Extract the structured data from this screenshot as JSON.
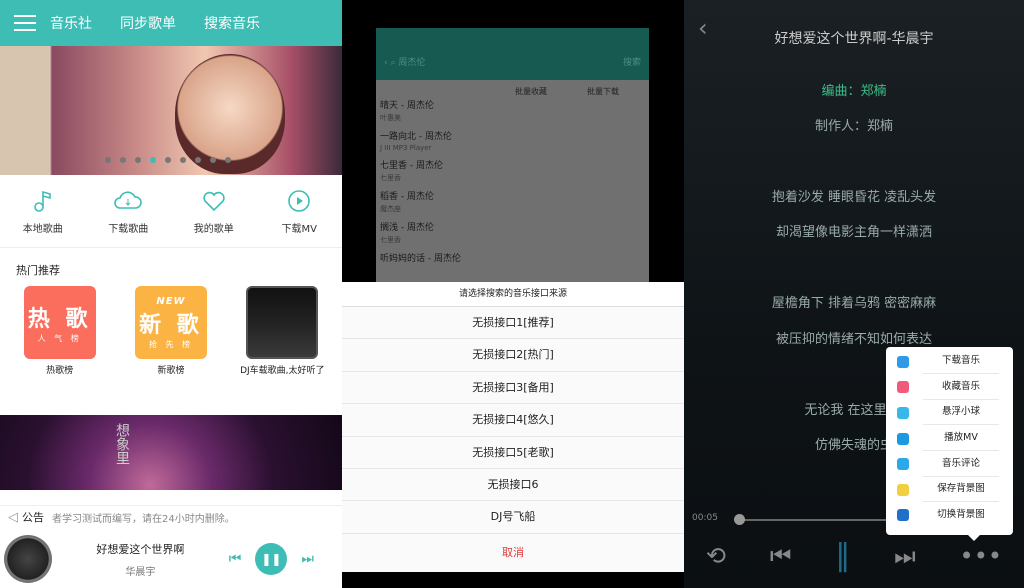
{
  "home": {
    "tabs": [
      "音乐社",
      "同步歌单",
      "搜索音乐"
    ],
    "quick": [
      {
        "label": "本地歌曲",
        "icon": "music-note-icon"
      },
      {
        "label": "下载歌曲",
        "icon": "cloud-download-icon"
      },
      {
        "label": "我的歌单",
        "icon": "heart-icon"
      },
      {
        "label": "下载MV",
        "icon": "play-circle-icon"
      }
    ],
    "section": "热门推荐",
    "cards": [
      {
        "label": "热歌榜",
        "big": "热 歌",
        "small": "人 气 榜",
        "color": "#fb6d5c"
      },
      {
        "label": "新歌榜",
        "big": "新 歌",
        "top": "NEW",
        "small": "抢 先 榜",
        "color": "#fbb444"
      },
      {
        "label": "DJ车载歌曲,太好听了"
      }
    ],
    "banner2_text": "想象里",
    "notice_label": "公告",
    "notice_text": "者学习测试而编写，请在24小时内删除。",
    "now_playing": {
      "title": "好想爱这个世界啊",
      "artist": "华晨宇"
    },
    "accent": "#3dbdb4"
  },
  "search": {
    "query": "周杰伦",
    "search_btn": "搜索",
    "batch_fav": "批量收藏",
    "batch_dl": "批量下载",
    "results": [
      {
        "title": "晴天 - 周杰伦",
        "sub": "叶惠美"
      },
      {
        "title": "一路向北 - 周杰伦",
        "sub": "J III MP3 Player"
      },
      {
        "title": "七里香 - 周杰伦",
        "sub": "七里香"
      },
      {
        "title": "稻香 - 周杰伦",
        "sub": "魔杰座"
      },
      {
        "title": "搁浅 - 周杰伦",
        "sub": "七里香"
      },
      {
        "title": "听妈妈的话 - 周杰伦",
        "sub": ""
      }
    ],
    "dialog_title": "请选择搜索的音乐接口来源",
    "options": [
      "无损接口1[推荐]",
      "无损接口2[热门]",
      "无损接口3[备用]",
      "无损接口4[悠久]",
      "无损接口5[老歌]",
      "无损接口6",
      "DJ号飞船"
    ],
    "cancel": "取消"
  },
  "player": {
    "title": "好想爱这个世界啊-华晨宇",
    "lyrics": [
      "编曲：郑楠",
      "制作人：郑楠",
      "抱着沙发 睡眼昏花 凌乱头发",
      "却渴望像电影主角一样潇洒",
      "屋檐角下 排着乌鸦 密密麻麻",
      "被压抑的情绪不知如何表达",
      "无论我 在这里 在",
      "仿佛失魂的虫"
    ],
    "menu": [
      {
        "label": "下载音乐",
        "color": "#2e9ae8"
      },
      {
        "label": "收藏音乐",
        "color": "#f25a7a"
      },
      {
        "label": "悬浮小球",
        "color": "#36b8e8"
      },
      {
        "label": "播放MV",
        "color": "#1a9ae0"
      },
      {
        "label": "音乐评论",
        "color": "#2aa8e8"
      },
      {
        "label": "保存背景图",
        "color": "#f0d040"
      },
      {
        "label": "切换背景图",
        "color": "#1e70c8"
      }
    ],
    "time": "00:05"
  }
}
